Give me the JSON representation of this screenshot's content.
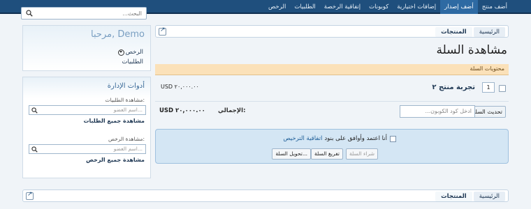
{
  "nav": {
    "items": [
      "أضف منتج",
      "أضف إصدار",
      "إضافات اختيارية",
      "كوبونات",
      "إتفاقية الرخصة",
      "الطلبيات",
      "الرخص"
    ],
    "active_index": 1
  },
  "search": {
    "placeholder": "البحث..."
  },
  "breadcrumb": {
    "items": [
      "الرئيسية",
      "المنتجات"
    ]
  },
  "page": {
    "title": "مشاهدة السلة"
  },
  "cart": {
    "header": "محتويات السلة",
    "item": {
      "name": "تجربة منتج ٢",
      "quantity": "1",
      "price": "USD ٢٠,٠٠٠.٠٠"
    },
    "update_button": "تحديث السلة",
    "coupon_placeholder": "ادخل كود الكوبون...",
    "total_label": "الإجمالي:",
    "total_value": "USD ٢٠,٠٠٠.٠٠"
  },
  "checkout": {
    "agree_text": "أنا اعتمد وأوافق على بنود",
    "agree_link": "اتفاقية الترخيص",
    "buy_button": "شراء السلة",
    "empty_button": "تفريغ السلة",
    "transfer_button": "تحويل السلة..."
  },
  "sidebar": {
    "welcome": {
      "title": "مرحبا, Demo",
      "licenses": "الرخص",
      "orders": "الطلبيات"
    },
    "admin": {
      "title": "أدوات الإدارة",
      "orders_label": "مشاهدة الطلبيات:",
      "orders_placeholder": "اسم العضو...",
      "orders_link": "مشاهدة جميع الطلبات",
      "licenses_label": "مشاهدة الرخص:",
      "licenses_placeholder": "اسم العضو...",
      "licenses_link": "مشاهدة جميع الرخص"
    }
  },
  "colors": {
    "topbar": "#1f4f7d",
    "accent": "#2e6aa3",
    "cart_header": "#fbe1b9",
    "checkout_box": "#d4e6f4"
  },
  "icons": [
    "search-icon",
    "jump-icon",
    "chevron-down-icon"
  ]
}
